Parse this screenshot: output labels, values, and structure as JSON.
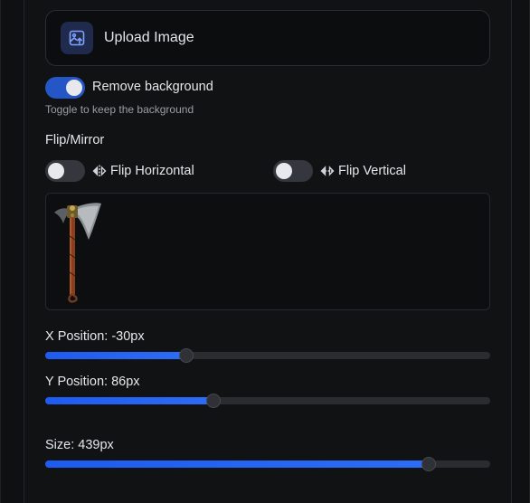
{
  "upload": {
    "label": "Upload Image"
  },
  "remove_background": {
    "label": "Remove background",
    "hint": "Toggle to keep the background",
    "enabled": true
  },
  "flip": {
    "section_label": "Flip/Mirror",
    "horizontal": {
      "label": "Flip Horizontal",
      "enabled": false
    },
    "vertical": {
      "label": "Flip Vertical",
      "enabled": false
    }
  },
  "preview": {
    "image": "axe-image"
  },
  "sliders": {
    "x": {
      "label": "X Position: -30px",
      "fraction": 0.317
    },
    "y": {
      "label": "Y Position: 86px",
      "fraction": 0.378
    },
    "size": {
      "label": "Size: 439px",
      "fraction": 0.862
    }
  },
  "colors": {
    "accent": "#2457c5",
    "slider_fill": "#1e5bf0",
    "background": "#0f1012"
  }
}
